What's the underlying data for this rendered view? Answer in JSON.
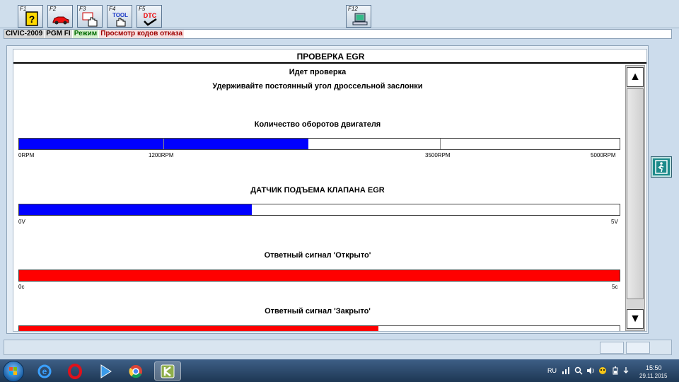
{
  "toolbar": {
    "keys": [
      {
        "label": "F1",
        "icon": "help-icon"
      },
      {
        "label": "F2",
        "icon": "car-icon"
      },
      {
        "label": "F3",
        "icon": "diagnostic-hand-icon"
      },
      {
        "label": "F4",
        "icon": "tool-icon"
      },
      {
        "label": "F5",
        "icon": "dtc-icon"
      },
      {
        "label": "F12",
        "icon": "computer-icon"
      }
    ],
    "tool_text": "TOOL",
    "dtc_text": "DTC"
  },
  "info": {
    "model": "CIVIC-2009",
    "system": "PGM FI",
    "mode_label": "Режим",
    "mode_value": "Просмотр кодов отказа"
  },
  "panel": {
    "title": "ПРОВЕРКА EGR",
    "status": "Идет проверка",
    "instruction": "Удерживайте постоянный угол дроссельной заслонки"
  },
  "gauges": [
    {
      "label": "Количество оборотов двигателя",
      "fill_fraction": 0.482,
      "fill_color": "#0000ff",
      "scale": [
        "0RPM",
        "1200RPM",
        "3500RPM",
        "5000RPM"
      ]
    },
    {
      "label": "ДАТЧИК ПОДЪЕМА КЛАПАНА EGR",
      "fill_fraction": 0.387,
      "fill_color": "#0000ff",
      "scale": [
        "0V",
        "5V"
      ]
    },
    {
      "label": "Ответный сигнал 'Открыто'",
      "fill_fraction": 1.0,
      "fill_color": "#ff0000",
      "scale": [
        "0c",
        "5c"
      ]
    },
    {
      "label": "Ответный сигнал 'Закрыто'",
      "fill_fraction": 0.598,
      "fill_color": "#ff0000",
      "scale": []
    }
  ],
  "scrollbar": {
    "up": "▲",
    "down": "▼"
  },
  "taskbar": {
    "apps": [
      "internet-explorer-icon",
      "opera-icon",
      "media-player-icon",
      "chrome-icon",
      "diagnostic-app-icon"
    ],
    "language": "RU",
    "time": "15:50",
    "date": "29.11.2015"
  },
  "colors": {
    "accent_blue": "#0000ff",
    "accent_red": "#ff0000"
  }
}
